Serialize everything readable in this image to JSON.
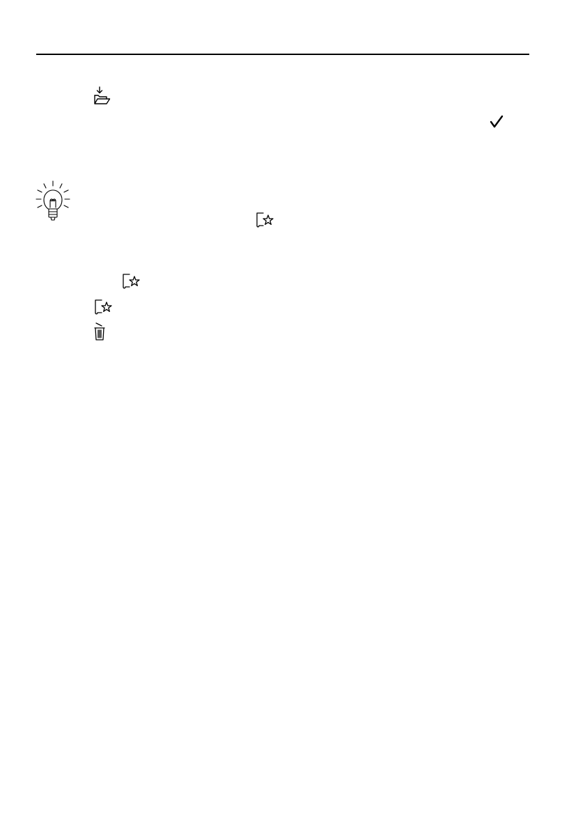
{
  "document": {
    "icons": {
      "header_rule": "horizontal-rule",
      "load_folder": "folder-download-icon",
      "confirm": "checkmark-icon",
      "tip": "lightbulb-icon",
      "favourite_inline": "favourite-document-star-icon",
      "favourite_step_indented": "favourite-document-star-icon",
      "favourite_step": "favourite-document-star-icon",
      "delete": "trash-delete-icon"
    },
    "text_color": "#000000",
    "background_color": "#ffffff"
  }
}
